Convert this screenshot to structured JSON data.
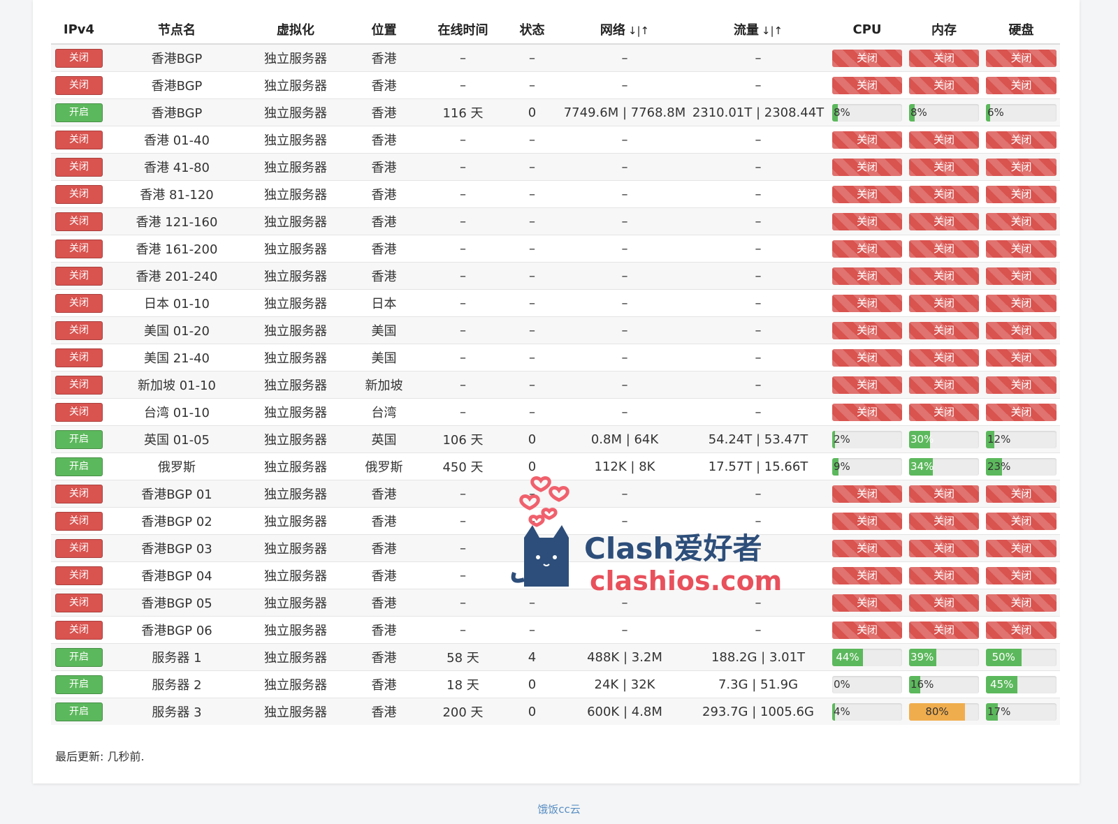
{
  "columns": [
    "IPv4",
    "节点名",
    "虚拟化",
    "位置",
    "在线时间",
    "状态",
    "网络",
    "流量",
    "CPU",
    "内存",
    "硬盘"
  ],
  "sort_arrows": "↓|↑",
  "rows": [
    {
      "ipv4": "关闭",
      "on": false,
      "name": "香港BGP",
      "virt": "独立服务器",
      "loc": "香港",
      "uptime": "–",
      "status": "–",
      "net": "–",
      "traffic": "–",
      "cpu": "关闭",
      "mem": "关闭",
      "disk": "关闭"
    },
    {
      "ipv4": "关闭",
      "on": false,
      "name": "香港BGP",
      "virt": "独立服务器",
      "loc": "香港",
      "uptime": "–",
      "status": "–",
      "net": "–",
      "traffic": "–",
      "cpu": "关闭",
      "mem": "关闭",
      "disk": "关闭"
    },
    {
      "ipv4": "开启",
      "on": true,
      "name": "香港BGP",
      "virt": "独立服务器",
      "loc": "香港",
      "uptime": "116 天",
      "status": "0",
      "net": "7749.6M | 7768.8M",
      "traffic": "2310.01T | 2308.44T",
      "cpu": "8%",
      "cpu_pct": 8,
      "mem": "8%",
      "mem_pct": 8,
      "disk": "6%",
      "disk_pct": 6
    },
    {
      "ipv4": "关闭",
      "on": false,
      "name": "香港 01-40",
      "virt": "独立服务器",
      "loc": "香港",
      "uptime": "–",
      "status": "–",
      "net": "–",
      "traffic": "–",
      "cpu": "关闭",
      "mem": "关闭",
      "disk": "关闭"
    },
    {
      "ipv4": "关闭",
      "on": false,
      "name": "香港 41-80",
      "virt": "独立服务器",
      "loc": "香港",
      "uptime": "–",
      "status": "–",
      "net": "–",
      "traffic": "–",
      "cpu": "关闭",
      "mem": "关闭",
      "disk": "关闭"
    },
    {
      "ipv4": "关闭",
      "on": false,
      "name": "香港 81-120",
      "virt": "独立服务器",
      "loc": "香港",
      "uptime": "–",
      "status": "–",
      "net": "–",
      "traffic": "–",
      "cpu": "关闭",
      "mem": "关闭",
      "disk": "关闭"
    },
    {
      "ipv4": "关闭",
      "on": false,
      "name": "香港 121-160",
      "virt": "独立服务器",
      "loc": "香港",
      "uptime": "–",
      "status": "–",
      "net": "–",
      "traffic": "–",
      "cpu": "关闭",
      "mem": "关闭",
      "disk": "关闭"
    },
    {
      "ipv4": "关闭",
      "on": false,
      "name": "香港 161-200",
      "virt": "独立服务器",
      "loc": "香港",
      "uptime": "–",
      "status": "–",
      "net": "–",
      "traffic": "–",
      "cpu": "关闭",
      "mem": "关闭",
      "disk": "关闭"
    },
    {
      "ipv4": "关闭",
      "on": false,
      "name": "香港 201-240",
      "virt": "独立服务器",
      "loc": "香港",
      "uptime": "–",
      "status": "–",
      "net": "–",
      "traffic": "–",
      "cpu": "关闭",
      "mem": "关闭",
      "disk": "关闭"
    },
    {
      "ipv4": "关闭",
      "on": false,
      "name": "日本 01-10",
      "virt": "独立服务器",
      "loc": "日本",
      "uptime": "–",
      "status": "–",
      "net": "–",
      "traffic": "–",
      "cpu": "关闭",
      "mem": "关闭",
      "disk": "关闭"
    },
    {
      "ipv4": "关闭",
      "on": false,
      "name": "美国 01-20",
      "virt": "独立服务器",
      "loc": "美国",
      "uptime": "–",
      "status": "–",
      "net": "–",
      "traffic": "–",
      "cpu": "关闭",
      "mem": "关闭",
      "disk": "关闭"
    },
    {
      "ipv4": "关闭",
      "on": false,
      "name": "美国 21-40",
      "virt": "独立服务器",
      "loc": "美国",
      "uptime": "–",
      "status": "–",
      "net": "–",
      "traffic": "–",
      "cpu": "关闭",
      "mem": "关闭",
      "disk": "关闭"
    },
    {
      "ipv4": "关闭",
      "on": false,
      "name": "新加坡 01-10",
      "virt": "独立服务器",
      "loc": "新加坡",
      "uptime": "–",
      "status": "–",
      "net": "–",
      "traffic": "–",
      "cpu": "关闭",
      "mem": "关闭",
      "disk": "关闭"
    },
    {
      "ipv4": "关闭",
      "on": false,
      "name": "台湾 01-10",
      "virt": "独立服务器",
      "loc": "台湾",
      "uptime": "–",
      "status": "–",
      "net": "–",
      "traffic": "–",
      "cpu": "关闭",
      "mem": "关闭",
      "disk": "关闭"
    },
    {
      "ipv4": "开启",
      "on": true,
      "name": "英国 01-05",
      "virt": "独立服务器",
      "loc": "英国",
      "uptime": "106 天",
      "status": "0",
      "net": "0.8M | 64K",
      "traffic": "54.24T | 53.47T",
      "cpu": "2%",
      "cpu_pct": 2,
      "mem": "30%",
      "mem_pct": 30,
      "disk": "12%",
      "disk_pct": 12
    },
    {
      "ipv4": "开启",
      "on": true,
      "name": "俄罗斯",
      "virt": "独立服务器",
      "loc": "俄罗斯",
      "uptime": "450 天",
      "status": "0",
      "net": "112K | 8K",
      "traffic": "17.57T | 15.66T",
      "cpu": "9%",
      "cpu_pct": 9,
      "mem": "34%",
      "mem_pct": 34,
      "disk": "23%",
      "disk_pct": 23
    },
    {
      "ipv4": "关闭",
      "on": false,
      "name": "香港BGP 01",
      "virt": "独立服务器",
      "loc": "香港",
      "uptime": "–",
      "status": "–",
      "net": "–",
      "traffic": "–",
      "cpu": "关闭",
      "mem": "关闭",
      "disk": "关闭"
    },
    {
      "ipv4": "关闭",
      "on": false,
      "name": "香港BGP 02",
      "virt": "独立服务器",
      "loc": "香港",
      "uptime": "–",
      "status": "–",
      "net": "–",
      "traffic": "–",
      "cpu": "关闭",
      "mem": "关闭",
      "disk": "关闭"
    },
    {
      "ipv4": "关闭",
      "on": false,
      "name": "香港BGP 03",
      "virt": "独立服务器",
      "loc": "香港",
      "uptime": "–",
      "status": "–",
      "net": "–",
      "traffic": "–",
      "cpu": "关闭",
      "mem": "关闭",
      "disk": "关闭"
    },
    {
      "ipv4": "关闭",
      "on": false,
      "name": "香港BGP 04",
      "virt": "独立服务器",
      "loc": "香港",
      "uptime": "–",
      "status": "–",
      "net": "–",
      "traffic": "–",
      "cpu": "关闭",
      "mem": "关闭",
      "disk": "关闭"
    },
    {
      "ipv4": "关闭",
      "on": false,
      "name": "香港BGP 05",
      "virt": "独立服务器",
      "loc": "香港",
      "uptime": "–",
      "status": "–",
      "net": "–",
      "traffic": "–",
      "cpu": "关闭",
      "mem": "关闭",
      "disk": "关闭"
    },
    {
      "ipv4": "关闭",
      "on": false,
      "name": "香港BGP 06",
      "virt": "独立服务器",
      "loc": "香港",
      "uptime": "–",
      "status": "–",
      "net": "–",
      "traffic": "–",
      "cpu": "关闭",
      "mem": "关闭",
      "disk": "关闭"
    },
    {
      "ipv4": "开启",
      "on": true,
      "name": "服务器 1",
      "virt": "独立服务器",
      "loc": "香港",
      "uptime": "58 天",
      "status": "4",
      "net": "488K | 3.2M",
      "traffic": "188.2G | 3.01T",
      "cpu": "44%",
      "cpu_pct": 44,
      "mem": "39%",
      "mem_pct": 39,
      "disk": "50%",
      "disk_pct": 50
    },
    {
      "ipv4": "开启",
      "on": true,
      "name": "服务器 2",
      "virt": "独立服务器",
      "loc": "香港",
      "uptime": "18 天",
      "status": "0",
      "net": "24K | 32K",
      "traffic": "7.3G | 51.9G",
      "cpu": "0%",
      "cpu_pct": 0,
      "mem": "16%",
      "mem_pct": 16,
      "disk": "45%",
      "disk_pct": 45
    },
    {
      "ipv4": "开启",
      "on": true,
      "name": "服务器 3",
      "virt": "独立服务器",
      "loc": "香港",
      "uptime": "200 天",
      "status": "0",
      "net": "600K | 4.8M",
      "traffic": "293.7G | 1005.6G",
      "cpu": "4%",
      "cpu_pct": 4,
      "mem": "80%",
      "mem_pct": 80,
      "disk": "17%",
      "disk_pct": 17
    }
  ],
  "last_updated": "最后更新: 几秒前.",
  "footer": "饿饭cc云",
  "watermark": {
    "brand": "Clash爱好者",
    "domain": "clashios.com"
  },
  "colors": {
    "off": "#d9534f",
    "on": "#5cb85c",
    "warn": "#f0ad4e",
    "link": "#5a8fc4"
  }
}
